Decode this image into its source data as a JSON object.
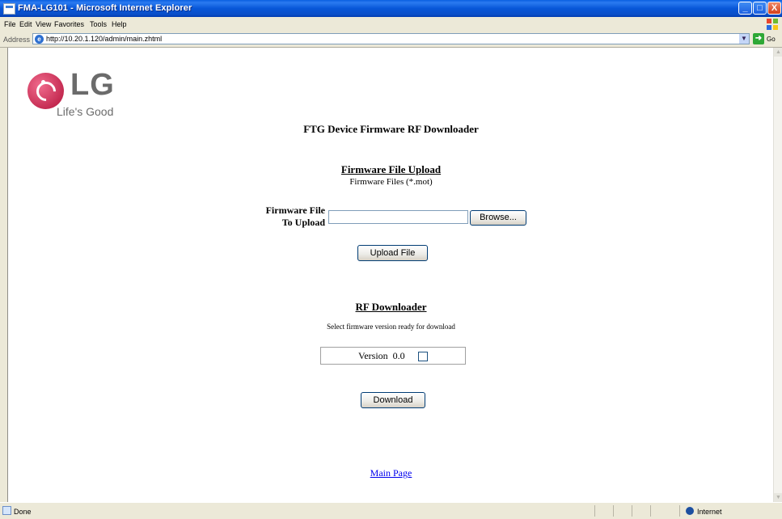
{
  "window": {
    "title": "FMA-LG101 - Microsoft Internet Explorer",
    "controls": [
      "_",
      "□",
      "X"
    ]
  },
  "menu": [
    "File",
    "Edit",
    "View",
    "Favorites",
    "Tools",
    "Help"
  ],
  "address": {
    "label": "Address",
    "url": "http://10.20.1.120/admin/main.zhtml",
    "go_label": "Go"
  },
  "logo": {
    "brand": "LG",
    "tagline": "Life's Good"
  },
  "page": {
    "title": "FTG Device Firmware RF Downloader",
    "upload": {
      "heading": "Firmware File Upload",
      "subtitle": "Firmware Files (*.mot)",
      "field_label_line1": "Firmware File",
      "field_label_line2": "To Upload",
      "browse_label": "Browse...",
      "upload_button": "Upload File"
    },
    "downloader": {
      "heading": "RF Downloader",
      "instruction": "Select firmware version ready for download",
      "version_label": "Version",
      "version_value": "0.0",
      "download_button": "Download"
    },
    "main_page_link": "Main Page"
  },
  "status": {
    "text": "Done",
    "zone": "Internet"
  }
}
